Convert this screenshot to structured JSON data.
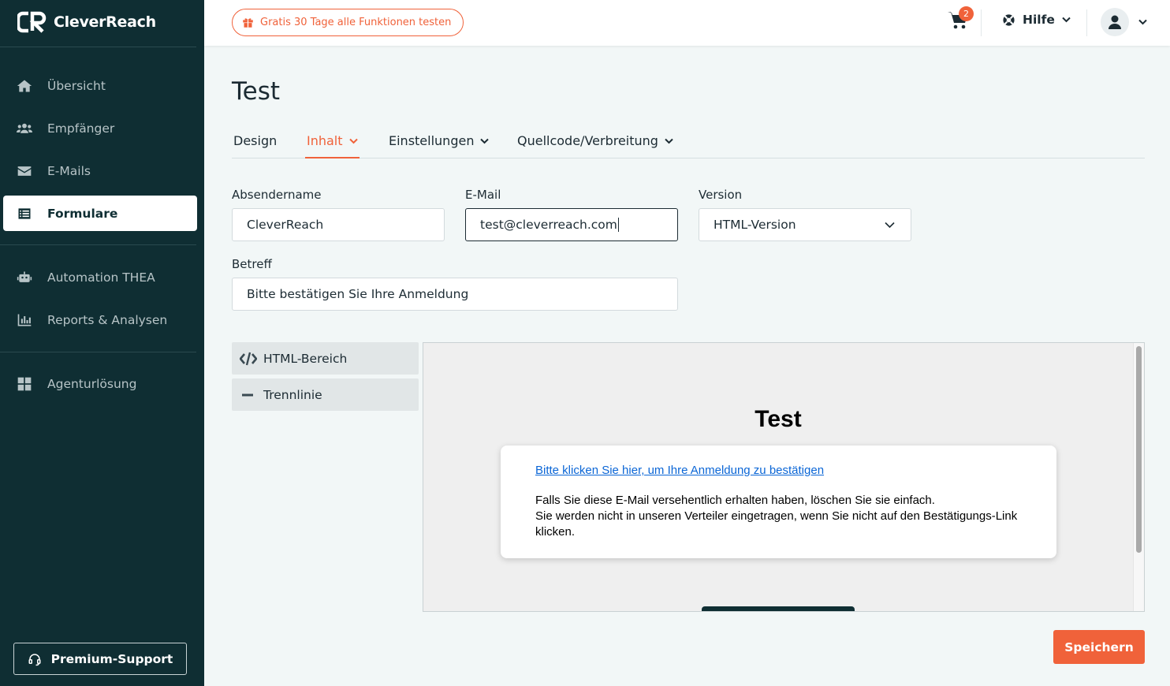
{
  "brand": {
    "name": "CleverReach",
    "accent": "#f0623a",
    "sidebar_bg": "#0f2e33"
  },
  "sidebar": {
    "items": [
      {
        "label": "Übersicht",
        "icon": "home-icon"
      },
      {
        "label": "Empfänger",
        "icon": "users-icon"
      },
      {
        "label": "E-Mails",
        "icon": "envelope-icon"
      },
      {
        "label": "Formulare",
        "icon": "list-icon",
        "active": true
      },
      {
        "label": "Automation THEA",
        "icon": "robot-icon"
      },
      {
        "label": "Reports & Analysen",
        "icon": "bar-chart-icon"
      },
      {
        "label": "Agenturlösung",
        "icon": "grid-icon"
      }
    ],
    "support_label": "Premium-Support"
  },
  "topbar": {
    "trial_label": "Gratis 30 Tage alle Funktionen testen",
    "cart_count": "2",
    "help_label": "Hilfe"
  },
  "page": {
    "title": "Test"
  },
  "tabs": [
    {
      "label": "Design",
      "dropdown": false
    },
    {
      "label": "Inhalt",
      "dropdown": true,
      "active": true
    },
    {
      "label": "Einstellungen",
      "dropdown": true
    },
    {
      "label": "Quellcode/Verbreitung",
      "dropdown": true
    }
  ],
  "form": {
    "sender_label": "Absendername",
    "sender_value": "CleverReach",
    "email_label": "E-Mail",
    "email_value": "test@cleverreach.com",
    "version_label": "Version",
    "version_value": "HTML-Version",
    "subject_label": "Betreff",
    "subject_value": "Bitte bestätigen Sie Ihre Anmeldung"
  },
  "blocks": [
    {
      "label": "HTML-Bereich",
      "icon": "code-icon"
    },
    {
      "label": "Trennlinie",
      "icon": "divider-icon"
    }
  ],
  "preview": {
    "title": "Test",
    "link": "Bitte klicken Sie hier, um Ihre Anmeldung zu bestätigen",
    "line1": "Falls Sie diese E-Mail versehentlich erhalten haben, löschen Sie sie einfach.",
    "line2": "Sie werden nicht in unseren Verteiler eingetragen, wenn Sie nicht auf den Bestätigungs-Link klicken."
  },
  "save_label": "Speichern"
}
